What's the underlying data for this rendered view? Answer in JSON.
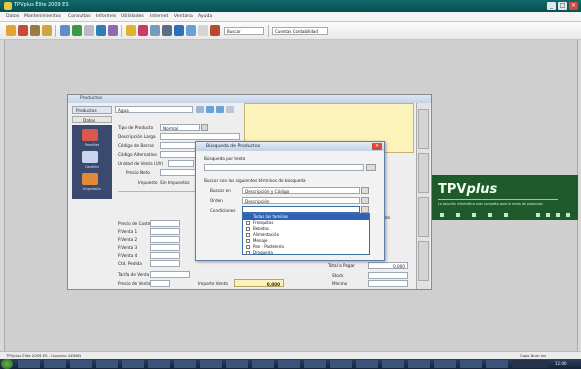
{
  "app": {
    "title": "TPVplus Élite 2009 ES",
    "menu": [
      "Datos",
      "Mantenimientos",
      "Consultas",
      "Informes",
      "Utilidades",
      "Internet",
      "Ventana",
      "Ayuda"
    ],
    "window_controls": [
      "_",
      "□",
      "×"
    ],
    "toolbar_search": "Buscar",
    "toolbar_field": "Cuentas Contabilidad"
  },
  "products_window": {
    "title": "Productos",
    "header_label": "Productos",
    "search_value": "Agua",
    "tab_label": "Datos",
    "sidebar": [
      {
        "label": "Familias",
        "icon": "box-icon"
      },
      {
        "label": "Gestión",
        "icon": "screen-icon"
      },
      {
        "label": "Impresión",
        "icon": "printer-icon"
      }
    ],
    "form_labels": [
      "Tipo de Producto",
      "Descripción Larga",
      "Código de Barras",
      "Código Alternativo",
      "Unidad de Venta (UV)",
      "Precio Neto",
      "Impuesto"
    ],
    "tipo_value": "Normal",
    "impuesto_value": "Sin Impuestos",
    "lower_labels": [
      "Precio de Coste",
      "P.Venta 1",
      "P.Venta 2",
      "P.Venta 3",
      "P.Venta 4"
    ],
    "extra_labels": [
      "Stock",
      "Pedido",
      "Reservado",
      "Mínimo"
    ],
    "oc_label": "Ctd. Pedida",
    "bottom_labels": [
      "Tarifa de Venta",
      "Precio de Venta",
      "Importe Venta"
    ],
    "bottom_value": "0,000",
    "total_label": "Total a Pagar",
    "total_value": "0,000",
    "right_tabs": [
      "Datos",
      "Notas",
      "Otros",
      "Varios"
    ]
  },
  "dialog": {
    "title": "Búsqueda de Productos",
    "section1": "Búsqueda por texto",
    "section2": "Buscar con los siguientes términos de búsqueda",
    "row1_label": "Buscar en",
    "row1_value": "Descripción y Código",
    "row2_label": "Orden",
    "row2_value": "Descripción",
    "row3_label": "Condiciones",
    "list_items": [
      "Todas las familias",
      "Fresquitos",
      "Bebidas",
      "Alimentación",
      "Menaje",
      "Pan - Pastelería",
      "Droguería"
    ],
    "selected_index": 0
  },
  "banner": {
    "brand": "TPV",
    "brand_suffix": "plus",
    "tagline": "La solución informática más completa para la venta de productos"
  },
  "statusbar": {
    "left": "TPVplus Élite 2009 ES - Usuario: ADMIN",
    "right": "Caps  Num  Ins"
  },
  "taskbar": {
    "clock": "12:00"
  },
  "colors": {
    "titlebar": "#0f6a6a",
    "selection": "#2f62b7",
    "banner": "#1e5a2a",
    "notes": "#fbf3b9"
  }
}
